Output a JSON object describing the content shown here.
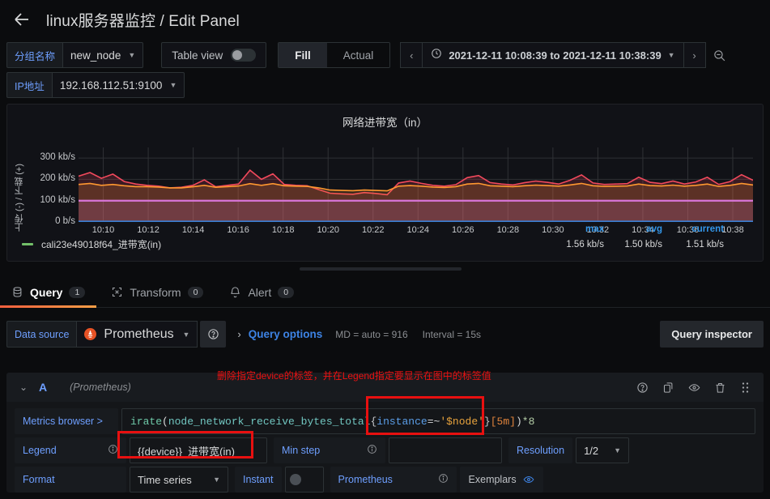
{
  "header": {
    "back_icon": "arrow-left-icon",
    "dashboard_name": "linux服务器监控",
    "separator": "/",
    "page": "Edit Panel",
    "title": "linux服务器监控 / Edit Panel"
  },
  "toolbar": {
    "variables": [
      {
        "label": "分组名称",
        "value": "new_node",
        "name": "group-name"
      },
      {
        "label": "IP地址",
        "value": "192.168.112.51:9100",
        "name": "ip-address"
      }
    ],
    "table_view_label": "Table view",
    "table_view_on": false,
    "fit_options": [
      "Fill",
      "Actual"
    ],
    "fit_selected": "Fill",
    "time_range": "2021-12-11 10:08:39 to 2021-12-11 10:38:39",
    "clock_icon": "clock-icon",
    "prev_icon": "chevron-left-icon",
    "next_icon": "chevron-right-icon",
    "zoom_out_icon": "zoom-out-icon"
  },
  "panel": {
    "title": "网络进带宽（in）",
    "legend": {
      "series_name": "cali23e49018f64_进带宽(in)",
      "color": "#73bf69",
      "stats": [
        {
          "label": "max",
          "value": "1.56 kb/s"
        },
        {
          "label": "avg",
          "value": "1.50 kb/s"
        },
        {
          "label": "current",
          "value": "1.51 kb/s"
        }
      ]
    }
  },
  "chart_data": {
    "type": "line",
    "title": "网络进带宽（in）",
    "xlabel": "",
    "ylabel": "上传 (-) / 下载 (+)",
    "grid": true,
    "legend_position": "bottom",
    "ylim": [
      0,
      350
    ],
    "ytick_labels": [
      "300 kb/s",
      "200 kb/s",
      "100 kb/s",
      "0 b/s"
    ],
    "ytick_values": [
      300,
      200,
      100,
      0
    ],
    "x": [
      "10:10",
      "10:12",
      "10:14",
      "10:16",
      "10:18",
      "10:20",
      "10:22",
      "10:24",
      "10:26",
      "10:28",
      "10:30",
      "10:32",
      "10:34",
      "10:36",
      "10:38"
    ],
    "xlim_times": [
      "10:08:39",
      "10:38:39"
    ],
    "series": [
      {
        "name": "series-red",
        "color": "#f2495c",
        "values": [
          215,
          232,
          205,
          225,
          190,
          178,
          172,
          168,
          160,
          163,
          172,
          198,
          165,
          172,
          178,
          243,
          200,
          226,
          176,
          172,
          170,
          152,
          135,
          132,
          130,
          138,
          134,
          128,
          183,
          192,
          181,
          172,
          168,
          175,
          208,
          218,
          185,
          178,
          174,
          184,
          192,
          186,
          178,
          196,
          221,
          183,
          176,
          178,
          180,
          210,
          186,
          180,
          192,
          178,
          188,
          210,
          176,
          190,
          222,
          196
        ]
      },
      {
        "name": "series-orange",
        "color": "#ff9830",
        "values": [
          176,
          181,
          172,
          176,
          170,
          166,
          166,
          164,
          160,
          160,
          165,
          172,
          163,
          166,
          169,
          180,
          172,
          180,
          170,
          168,
          167,
          160,
          150,
          148,
          147,
          150,
          148,
          146,
          168,
          171,
          168,
          164,
          162,
          166,
          178,
          181,
          170,
          168,
          166,
          170,
          173,
          171,
          168,
          174,
          181,
          170,
          167,
          168,
          169,
          178,
          171,
          169,
          173,
          168,
          172,
          178,
          167,
          172,
          181,
          174
        ]
      },
      {
        "name": "series-magenta",
        "color": "#d976d9",
        "constant": 100
      },
      {
        "name": "series-blue",
        "color": "#3a7fd5",
        "constant": 2
      }
    ]
  },
  "tabs": [
    {
      "label": "Query",
      "count": "1",
      "icon": "database-icon",
      "active": true
    },
    {
      "label": "Transform",
      "count": "0",
      "icon": "transform-icon",
      "active": false
    },
    {
      "label": "Alert",
      "count": "0",
      "icon": "bell-icon",
      "active": false
    }
  ],
  "datasource_row": {
    "label": "Data source",
    "value": "Prometheus",
    "icon": "prometheus-icon",
    "help_icon": "help-circle-icon",
    "expand_icon": "chevron-right-icon",
    "query_options_label": "Query options",
    "md_text": "MD = auto = 916",
    "interval_text": "Interval = 15s",
    "query_inspector_label": "Query inspector"
  },
  "query": {
    "collapse_icon": "chevron-down-icon",
    "ref_id": "A",
    "datasource_note": "(Prometheus)",
    "row_icons": [
      "help-circle-icon",
      "duplicate-icon",
      "eye-icon",
      "trash-icon",
      "drag-handle-icon"
    ],
    "metrics_browser_label": "Metrics browser >",
    "expression": "irate(node_network_receive_bytes_total{instance=~'$node'}[5m])*8",
    "expression_tokens": {
      "fn": "irate",
      "open": "(",
      "metric": "node_network_receive_bytes_total",
      "brace_open": "{",
      "key": "instance",
      "op": "=~",
      "str": "'$node'",
      "brace_close": "}",
      "range": "[5m]",
      "close": ")",
      "mult": "*8"
    },
    "legend_label": "Legend",
    "legend_value": "{{device}}_进带宽(in)",
    "min_step_label": "Min step",
    "min_step_value": "",
    "resolution_label": "Resolution",
    "resolution_value": "1/2",
    "format_label": "Format",
    "format_value": "Time series",
    "instant_label": "Instant",
    "instant_on": false,
    "prometheus_label": "Prometheus",
    "exemplars_label": "Exemplars",
    "exemplars_icon": "eye-icon",
    "info_icon": "info-circle-icon"
  },
  "annotation": {
    "text": "删除指定device的标签，并在Legend指定要显示在图中的标签值",
    "color": "#ee1111"
  }
}
